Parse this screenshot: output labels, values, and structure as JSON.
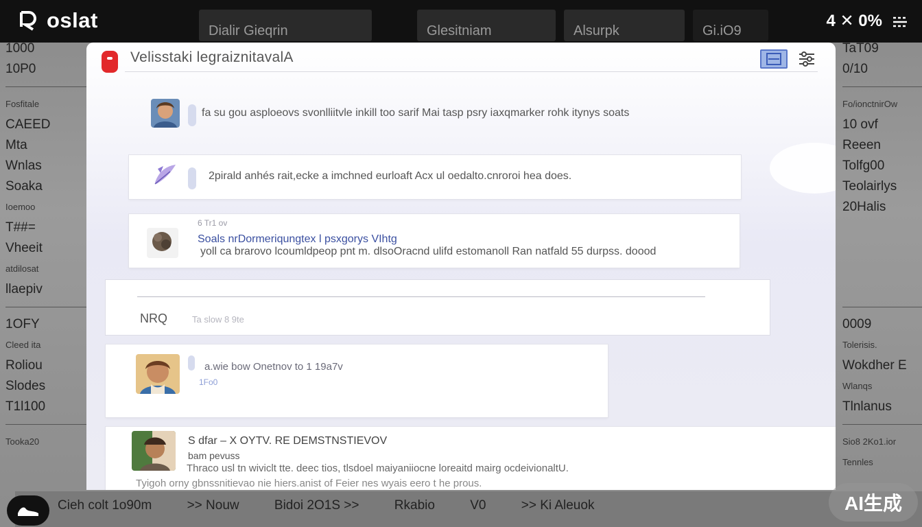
{
  "app": {
    "brand": "oslat",
    "tabs": [
      "Dialir Gieqrin",
      "Glesitniam",
      "Alsurpk",
      "Gi.iO9"
    ],
    "status": "4 ✕ 0%"
  },
  "left_sidebar": {
    "items": [
      "1000",
      "10P0",
      "Fosfitale",
      "CAEED",
      "Mta",
      "Wnlas",
      "Soaka",
      "Ioemoo",
      "T##=",
      "Vheeit",
      "atdilosat",
      "llaepiv",
      "1OFY",
      "Cleed ita",
      "Roliou",
      "Slodes",
      "T1l100",
      "Tooka20"
    ]
  },
  "right_sidebar": {
    "items": [
      "TaT09",
      "0/10",
      "Fo/ionctnirOw",
      "10 ovf",
      "Reeen",
      "Tolfg00",
      "Teolairlys",
      "20Halis",
      "0009",
      "Tolerisis.",
      "Wokdher E",
      "Wlanqs",
      "Tlnlanus",
      "Sio8 2Ko1.ior",
      "Tennles"
    ]
  },
  "bottom_bar": {
    "items": [
      "Cieh colt 1o90m",
      ">> Nouw",
      "Bidoi 2O1S >>",
      "Rkabio",
      "V0",
      ">> Ki Aleuok"
    ]
  },
  "panel": {
    "title": "Velisstaki legraiznitavalA",
    "rows": [
      {
        "text": "fa su gou asploeovs svonlliitvle inkill too sarif Mai tasp psry iaxqmarker rohk itynys soats"
      },
      {
        "text": "2pirald anhés rait,ecke a imchned eurloaft Acx ul oedalto.cnroroi hea does."
      },
      {
        "meta": "6 Tr1 ov",
        "title": "Soals nrDormeriqungtex l psxgorys VIhtg",
        "text": "yoll ca brarovo lcoumldpeop pnt m. dlsoOracnd ulifd estomanoll Ran natfald 55 durpss. doood"
      }
    ],
    "reply": {
      "label": "NRQ",
      "hint": "Ta slow 8 9te"
    },
    "comment": {
      "text": "a.wie bow Onetnov to 1 19a7v",
      "sub": "1Fo0"
    },
    "post": {
      "title": "S dfar –  X OYTV. RE  DEMSTNSTIEVOV",
      "sub": "bam pevuss",
      "line1": "Thraco usl tn wiviclt tte. deec tios, tlsdoel maiyaniiocne loreaitd mairg ocdeivionaltU.",
      "line2": "Tyigoh orny gbnssnitievao nie hiers.anist of Feier nes wyais eero t he prous."
    }
  },
  "watermark": "AI生成",
  "colors": {
    "record": "#e2292b",
    "topbar": "#111111",
    "panel": "#ffffff",
    "accent": "#5876c9"
  }
}
